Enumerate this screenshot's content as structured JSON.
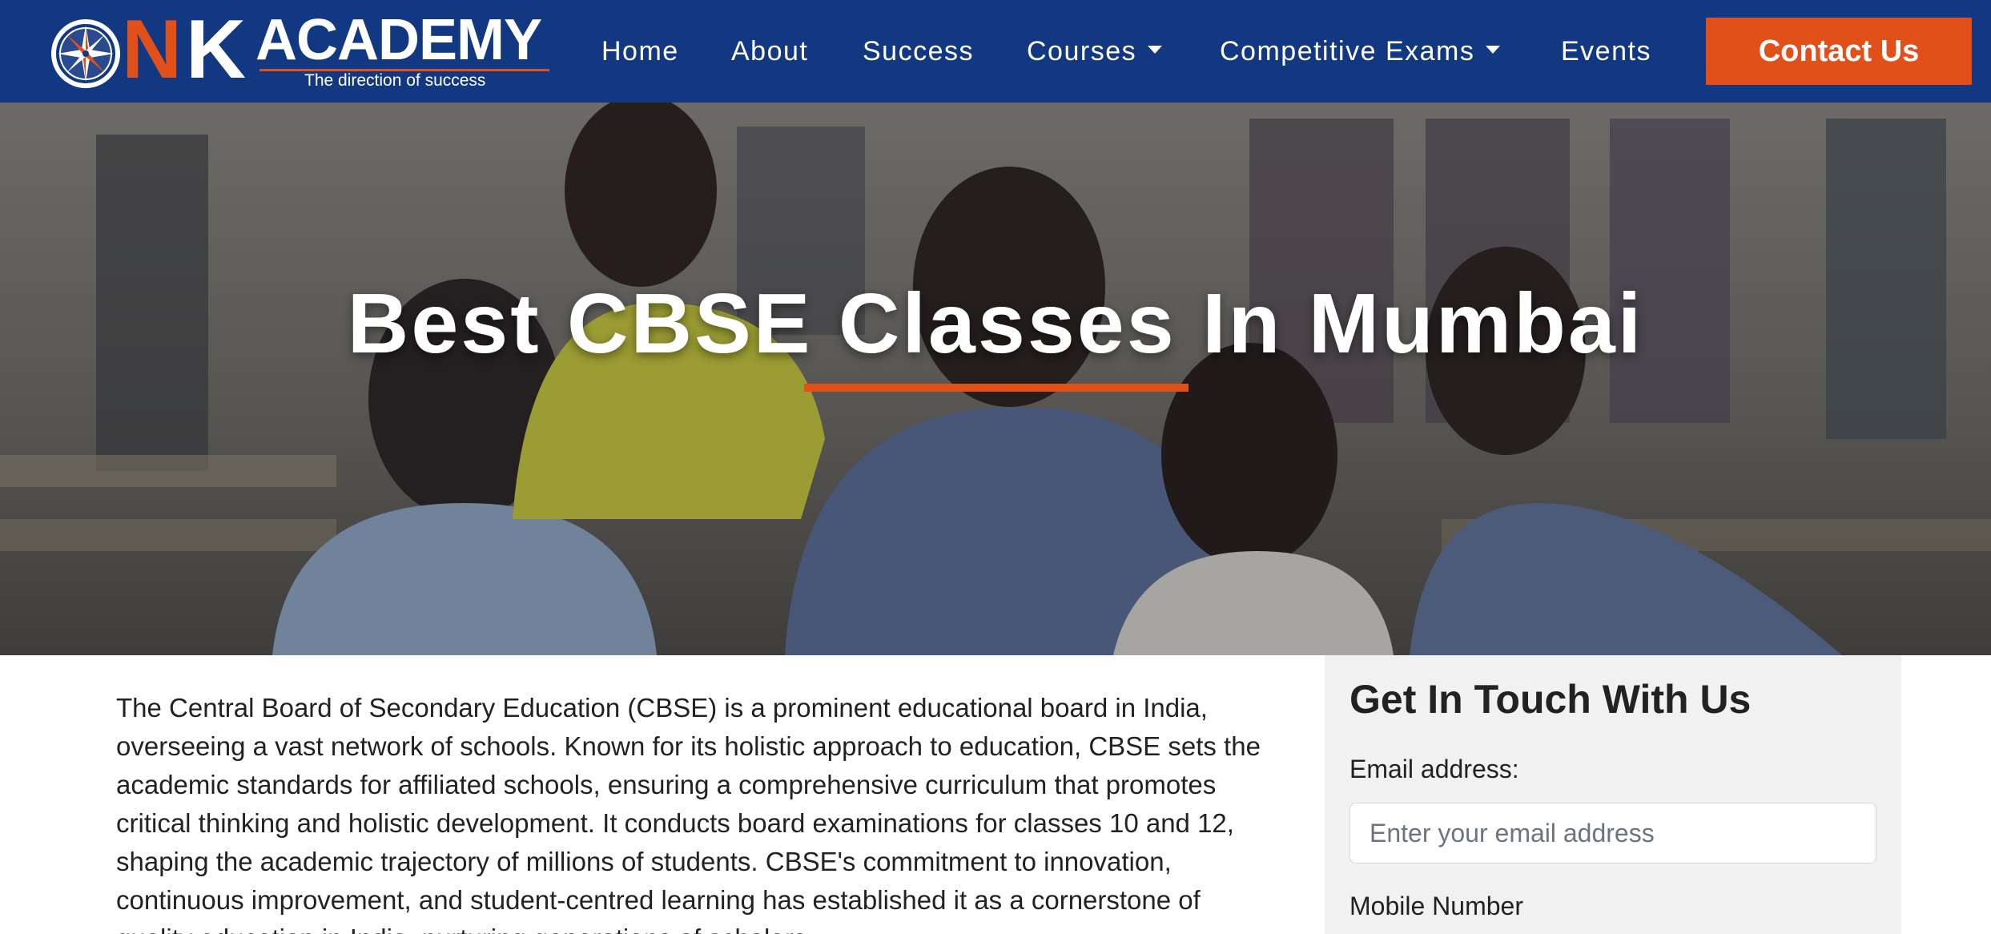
{
  "brand": {
    "letter_n": "N",
    "letter_k": "K",
    "name": "ACADEMY",
    "tagline": "The direction of success",
    "color_primary": "#133882",
    "color_accent": "#e2501a"
  },
  "nav": {
    "items": [
      {
        "label": "Home"
      },
      {
        "label": "About"
      },
      {
        "label": "Success"
      },
      {
        "label": "Courses",
        "icon": "caret-down-icon"
      },
      {
        "label": "Competitive Exams",
        "icon": "caret-down-icon"
      },
      {
        "label": "Events"
      }
    ],
    "contact_label": "Contact Us"
  },
  "hero": {
    "title": "Best CBSE Classes In Mumbai"
  },
  "intro": {
    "text": "The Central Board of Secondary Education (CBSE) is a prominent educational board in India, overseeing a vast network of schools. Known for its holistic approach to education, CBSE sets the academic standards for affiliated schools, ensuring a comprehensive curriculum that promotes critical thinking and holistic development. It conducts board examinations for classes 10 and 12, shaping the academic trajectory of millions of students. CBSE's commitment to innovation, continuous improvement, and student-centred learning has established it as a cornerstone of quality education in India, nurturing generations of scholars."
  },
  "form": {
    "title": "Get In Touch With Us",
    "email_label": "Email address:",
    "email_placeholder": "Enter your email address",
    "email_value": "",
    "mobile_label": "Mobile Number"
  }
}
